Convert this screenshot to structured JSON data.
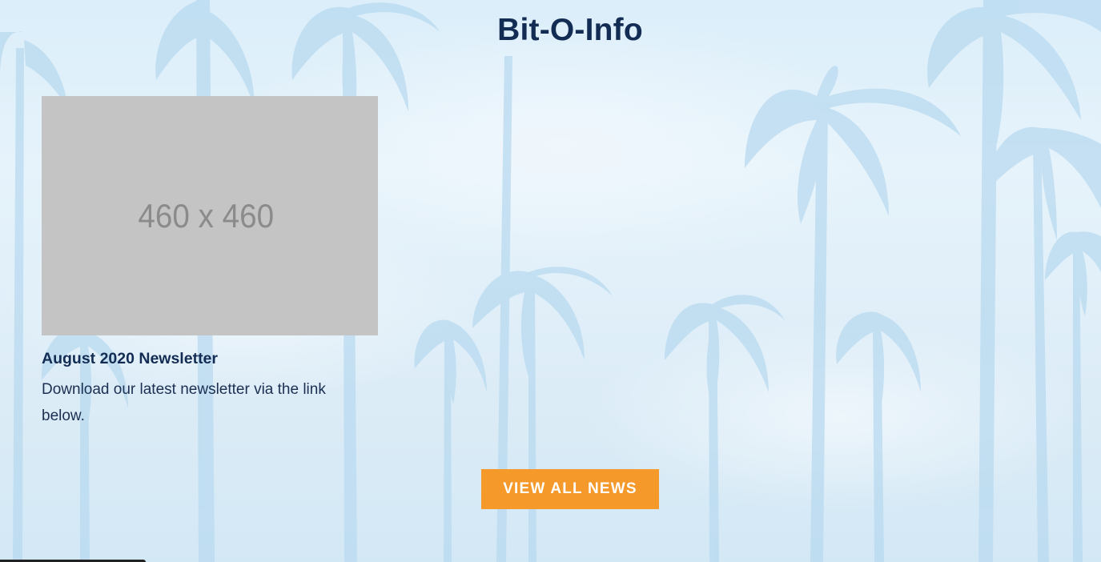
{
  "section": {
    "title": "Bit-O-Info"
  },
  "news_card": {
    "thumbnail_placeholder": "460 x 460",
    "title": "August 2020 Newsletter",
    "excerpt": "Download our latest newsletter via the link below."
  },
  "actions": {
    "view_all_label": "VIEW ALL NEWS"
  },
  "colors": {
    "title_navy": "#132c53",
    "accent_orange": "#f5992b",
    "placeholder_gray": "#c4c4c4",
    "sky_light_blue": "#dcecf7"
  }
}
